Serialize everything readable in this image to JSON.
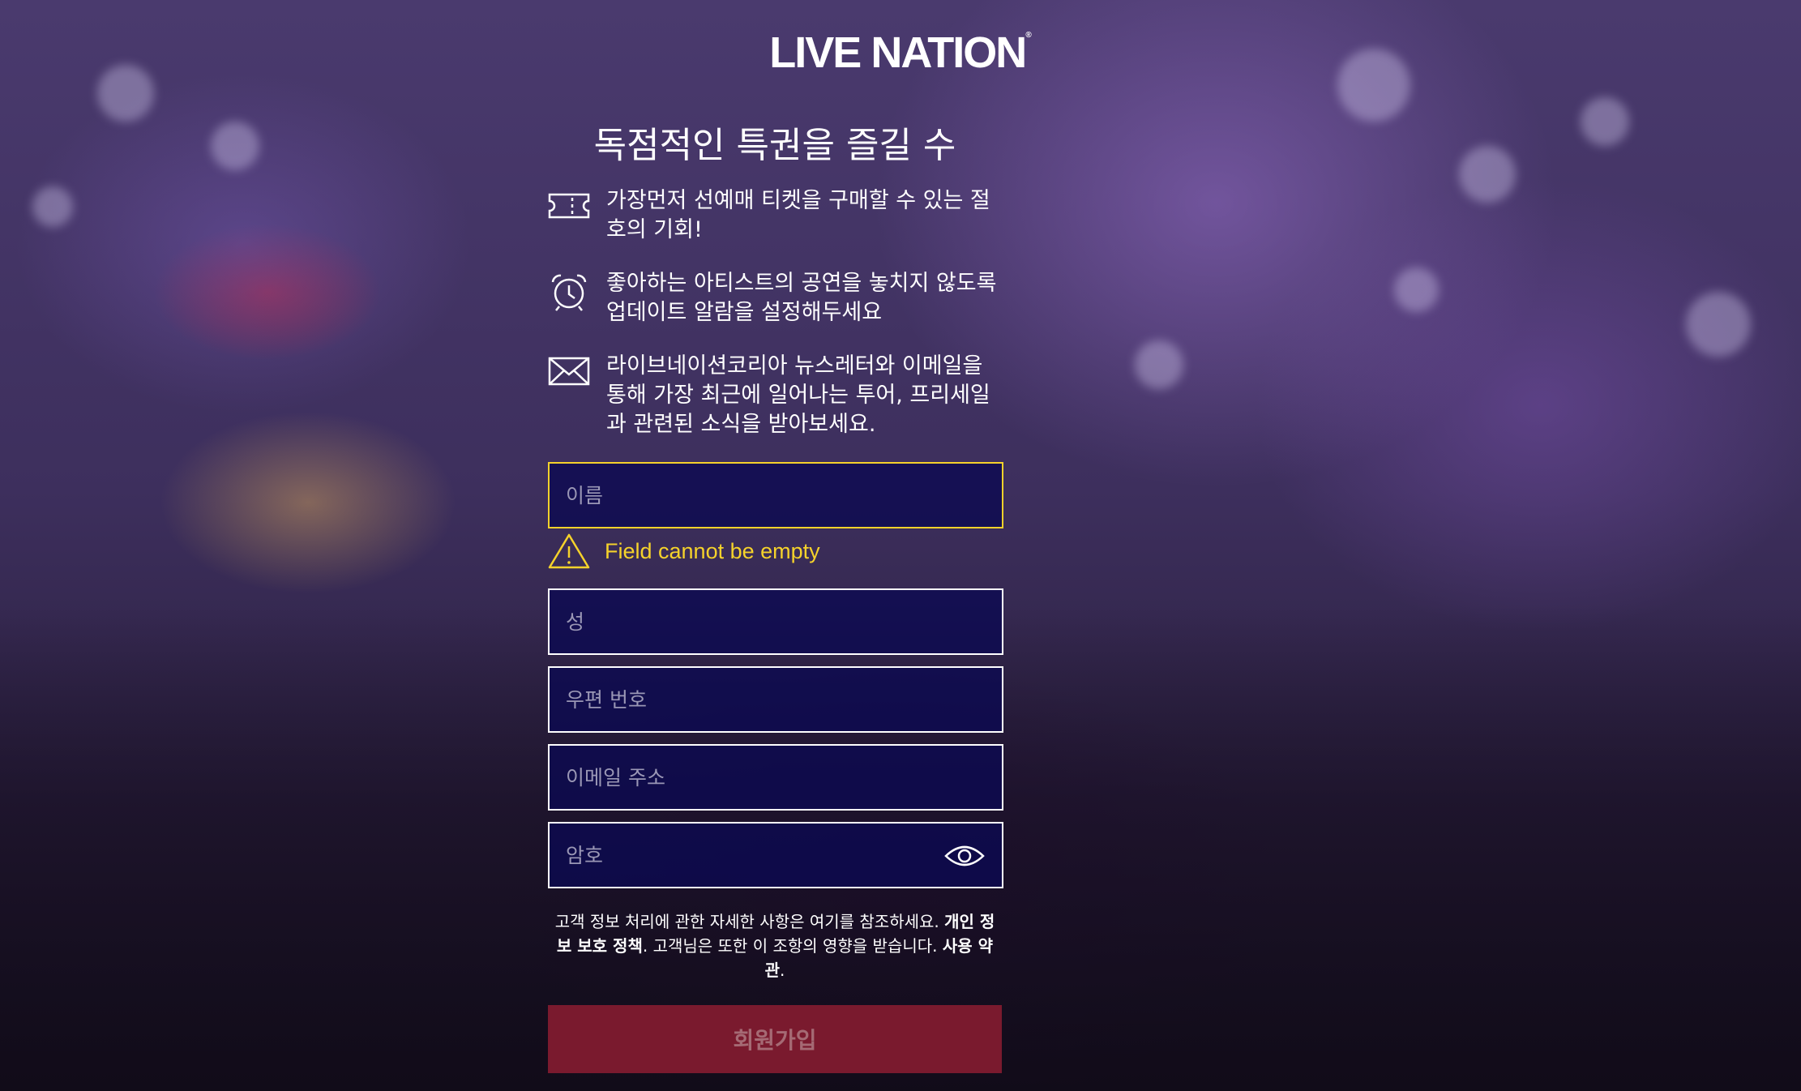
{
  "brand": {
    "name": "LIVE NATION",
    "mark": "®"
  },
  "headline": "독점적인 특권을 즐길 수",
  "features": [
    {
      "icon": "ticket-icon",
      "text": "가장먼저 선예매 티켓을 구매할 수 있는 절호의 기회!"
    },
    {
      "icon": "alarm-clock-icon",
      "text": "좋아하는 아티스트의 공연을 놓치지 않도록 업데이트 알람을 설정해두세요"
    },
    {
      "icon": "envelope-icon",
      "text": "라이브네이션코리아 뉴스레터와 이메일을 통해 가장 최근에 일어나는 투어, 프리세일과 관련된 소식을 받아보세요."
    }
  ],
  "form": {
    "first_name": {
      "placeholder": "이름",
      "value": ""
    },
    "error": "Field cannot be empty",
    "last_name": {
      "placeholder": "성",
      "value": ""
    },
    "postal_code": {
      "placeholder": "우편 번호",
      "value": ""
    },
    "email": {
      "placeholder": "이메일 주소",
      "value": ""
    },
    "password": {
      "placeholder": "암호",
      "value": ""
    }
  },
  "legal": {
    "text1": "고객 정보 처리에 관한 자세한 사항은 여기를 참조하세요. ",
    "privacy_link": "개인 정보 보호 정책",
    "text2": ". 고객님은 또한 이 조항의 영향을 받습니다. ",
    "terms_link": "사용 약관",
    "text3": "."
  },
  "submit_label": "회원가입",
  "colors": {
    "error": "#f5d22b",
    "field_bg": "#0c0a50",
    "button": "#7a1a2e"
  }
}
